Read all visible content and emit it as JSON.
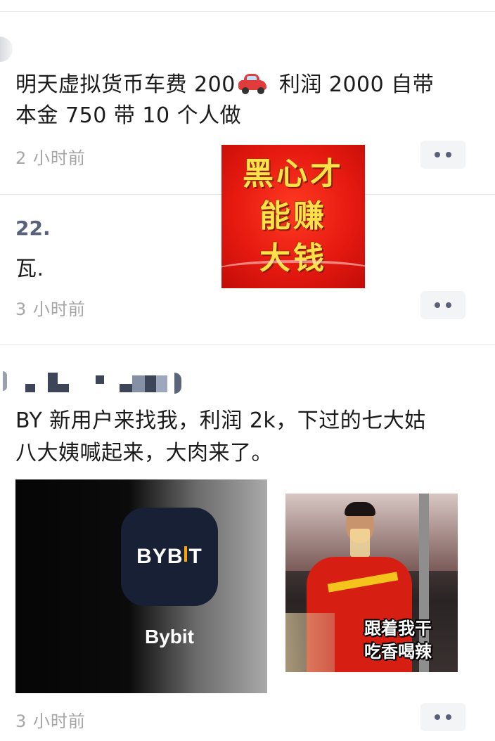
{
  "posts": [
    {
      "text_before": "明天虚拟货币车费 200",
      "emoji": "car-icon",
      "text_after_line1": " 利润 2000 自带",
      "text_line2": "本金 750 带 10 个人做",
      "time": "2 小时前"
    },
    {
      "name": "22.",
      "text": "瓦.",
      "time": "3 小时前"
    },
    {
      "text_line1": "BY 新用户来找我，利润 2k，下过的七大姑",
      "text_line2": "八大姨喊起来，大肉来了。",
      "time": "3 小时前"
    }
  ],
  "sticker": {
    "lines": [
      "黑心才",
      "能赚",
      "大钱"
    ]
  },
  "bybit_card": {
    "logo_left": "BYB",
    "logo_right": "T",
    "name": "Bybit"
  },
  "meme": {
    "caption_line1": "跟着我干",
    "caption_line2": "吃香喝辣"
  },
  "colors": {
    "accent_name": "#56627c",
    "time_gray": "#a6a6a6",
    "sticker_red": "#e61a10",
    "sticker_yellow": "#ffe24a",
    "bybit_orange": "#f7a600"
  }
}
